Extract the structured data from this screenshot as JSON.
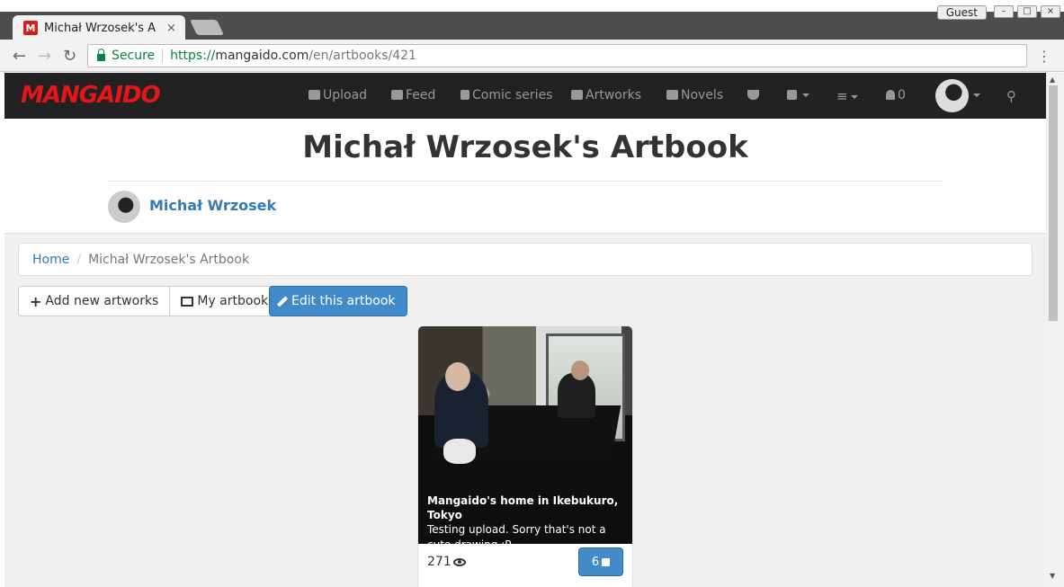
{
  "browser": {
    "tab_title": "Michał Wrzosek's A",
    "tab_close": "×",
    "guest_label": "Guest",
    "secure_label": "Secure",
    "url_scheme": "https://",
    "url_host": "mangaido.com",
    "url_path": "/en/artbooks/421"
  },
  "navbar": {
    "logo": "MANGAIDO",
    "items": [
      {
        "label": "Upload",
        "icon": "cloud-upload-icon"
      },
      {
        "label": "Feed",
        "icon": "comments-icon"
      },
      {
        "label": "Comic series",
        "icon": "book-icon"
      },
      {
        "label": "Artworks",
        "icon": "image-icon"
      },
      {
        "label": "Novels",
        "icon": "edit-icon"
      }
    ],
    "notifications_count": "0"
  },
  "header": {
    "title": "Michał Wrzosek's Artbook",
    "author": "Michał Wrzosek"
  },
  "breadcrumb": {
    "home": "Home",
    "separator": "/",
    "current": "Michał Wrzosek's Artbook"
  },
  "actions": {
    "add_artworks": "Add new artworks",
    "my_artbooks": "My artbooks",
    "edit_artbook": "Edit this artbook"
  },
  "artwork": {
    "title": "Mangaido's home in Ikebukuro, Tokyo",
    "description": "Testing upload. Sorry that's not a cute drawing :P",
    "views": "271",
    "likes": "6"
  },
  "colors": {
    "brand": "#e4161a",
    "navbar_bg": "#222222",
    "link": "#337ab7",
    "primary": "#428bca"
  }
}
